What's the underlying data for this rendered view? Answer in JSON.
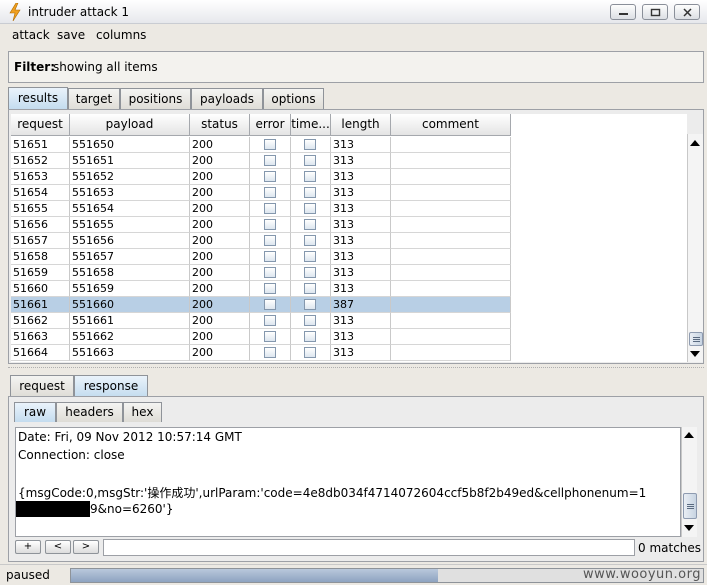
{
  "window": {
    "title": "intruder attack 1"
  },
  "menu": {
    "items": [
      "attack",
      "save",
      "columns"
    ]
  },
  "filter": {
    "label": "Filter:",
    "text": "showing all items"
  },
  "main_tabs": [
    "results",
    "target",
    "positions",
    "payloads",
    "options"
  ],
  "table": {
    "columns": [
      "request",
      "payload",
      "status",
      "error",
      "time...",
      "length",
      "comment"
    ],
    "rows": [
      {
        "request": "51651",
        "payload": "551650",
        "status": "200",
        "length": "313"
      },
      {
        "request": "51652",
        "payload": "551651",
        "status": "200",
        "length": "313"
      },
      {
        "request": "51653",
        "payload": "551652",
        "status": "200",
        "length": "313"
      },
      {
        "request": "51654",
        "payload": "551653",
        "status": "200",
        "length": "313"
      },
      {
        "request": "51655",
        "payload": "551654",
        "status": "200",
        "length": "313"
      },
      {
        "request": "51656",
        "payload": "551655",
        "status": "200",
        "length": "313"
      },
      {
        "request": "51657",
        "payload": "551656",
        "status": "200",
        "length": "313"
      },
      {
        "request": "51658",
        "payload": "551657",
        "status": "200",
        "length": "313"
      },
      {
        "request": "51659",
        "payload": "551658",
        "status": "200",
        "length": "313"
      },
      {
        "request": "51660",
        "payload": "551659",
        "status": "200",
        "length": "313"
      },
      {
        "request": "51661",
        "payload": "551660",
        "status": "200",
        "length": "387",
        "selected": true
      },
      {
        "request": "51662",
        "payload": "551661",
        "status": "200",
        "length": "313"
      },
      {
        "request": "51663",
        "payload": "551662",
        "status": "200",
        "length": "313"
      },
      {
        "request": "51664",
        "payload": "551663",
        "status": "200",
        "length": "313"
      }
    ]
  },
  "detail_tabs": [
    "request",
    "response"
  ],
  "view_tabs": [
    "raw",
    "headers",
    "hex"
  ],
  "response": {
    "lines": [
      "Date: Fri, 09 Nov 2012 10:57:14 GMT",
      "Connection: close",
      "",
      "{msgCode:0,msgStr:'操作成功',urlParam:'code=4e8db034f4714072604ccf5b8f2b49ed&cellphonenum=1",
      "9&no=6260'}"
    ]
  },
  "search": {
    "buttons": [
      "+",
      "<",
      ">"
    ],
    "value": "",
    "matches": "0 matches"
  },
  "status": {
    "text": "paused",
    "progress": 0.58
  },
  "watermark": "www.wooyun.org",
  "colors": {
    "selected_row": "#b8cfe5",
    "active_tab": "#c4dcef"
  }
}
